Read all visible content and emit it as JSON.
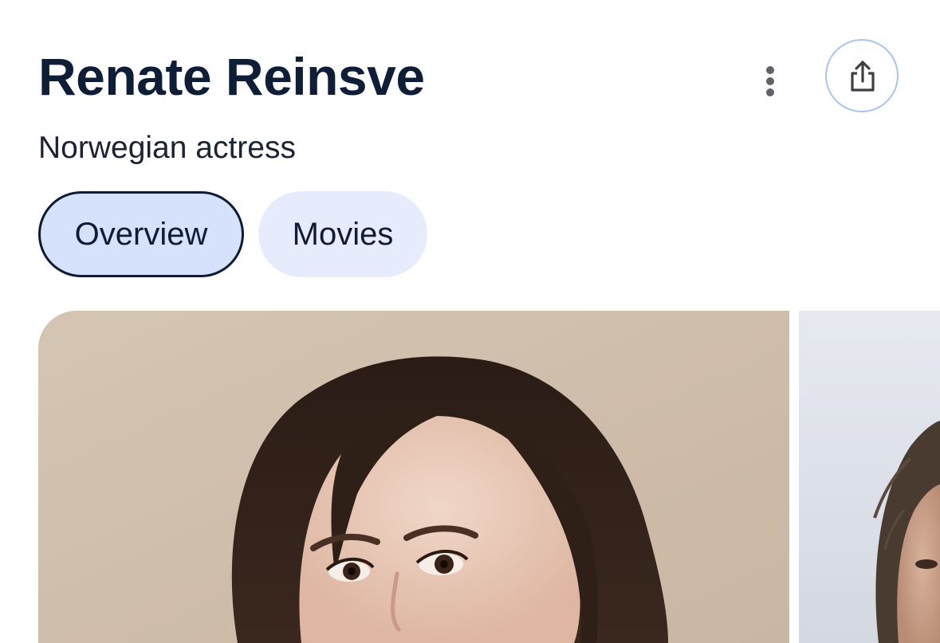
{
  "header": {
    "title": "Renate Reinsve",
    "subtitle": "Norwegian actress"
  },
  "actions": {
    "more": "more-vert-icon",
    "share": "share-icon"
  },
  "tabs": [
    {
      "label": "Overview",
      "selected": true
    },
    {
      "label": "Movies",
      "selected": false
    }
  ],
  "images": [
    {
      "subject": "portrait photo"
    },
    {
      "subject": "portrait photo"
    }
  ],
  "colors": {
    "title_text": "#0e1e36",
    "selected_tab_bg": "#d6e2fb",
    "tab_bg": "#e6ecfb",
    "share_border": "#a9c3ee"
  }
}
